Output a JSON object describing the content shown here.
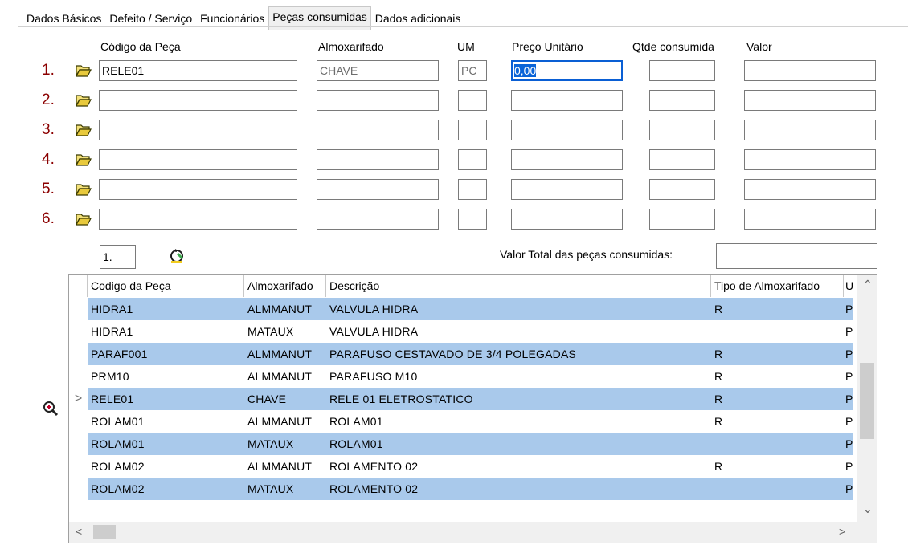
{
  "tabs": [
    {
      "label": "Dados Básicos"
    },
    {
      "label": "Defeito / Serviço"
    },
    {
      "label": "Funcionários"
    },
    {
      "label": "Peças consumidas"
    },
    {
      "label": "Dados adicionais"
    }
  ],
  "active_tab": "Peças consumidas",
  "columns": {
    "codigo": "Código da Peça",
    "almox": "Almoxarifado",
    "um": "UM",
    "preco": "Preço Unitário",
    "qtde": "Qtde consumida",
    "valor": "Valor"
  },
  "rows": [
    {
      "num": "1.",
      "codigo": "RELE01",
      "almox": "CHAVE",
      "um": "PC",
      "preco": "0,00",
      "qtde": "",
      "valor": ""
    },
    {
      "num": "2.",
      "codigo": "",
      "almox": "",
      "um": "",
      "preco": "",
      "qtde": "",
      "valor": ""
    },
    {
      "num": "3.",
      "codigo": "",
      "almox": "",
      "um": "",
      "preco": "",
      "qtde": "",
      "valor": ""
    },
    {
      "num": "4.",
      "codigo": "",
      "almox": "",
      "um": "",
      "preco": "",
      "qtde": "",
      "valor": ""
    },
    {
      "num": "5.",
      "codigo": "",
      "almox": "",
      "um": "",
      "preco": "",
      "qtde": "",
      "valor": ""
    },
    {
      "num": "6.",
      "codigo": "",
      "almox": "",
      "um": "",
      "preco": "",
      "qtde": "",
      "valor": ""
    }
  ],
  "page_field": "1.",
  "total_label": "Valor Total das peças consumidas:",
  "total_value": "",
  "grid": {
    "headers": [
      "Codigo da Peça",
      "Almoxarifado",
      "Descrição",
      "Tipo de Almoxarifado",
      "U"
    ],
    "rows": [
      {
        "codigo": "HIDRA1",
        "almox": "ALMMANUT",
        "descricao": "VALVULA HIDRA",
        "tipo": "R",
        "u": "P"
      },
      {
        "codigo": "HIDRA1",
        "almox": "MATAUX",
        "descricao": "VALVULA HIDRA",
        "tipo": "",
        "u": "P"
      },
      {
        "codigo": "PARAF001",
        "almox": "ALMMANUT",
        "descricao": "PARAFUSO CESTAVADO DE 3/4 POLEGADAS",
        "tipo": "R",
        "u": "P"
      },
      {
        "codigo": "PRM10",
        "almox": "ALMMANUT",
        "descricao": "PARAFUSO M10",
        "tipo": "R",
        "u": "P"
      },
      {
        "codigo": "RELE01",
        "almox": "CHAVE",
        "descricao": "RELE 01 ELETROSTATICO",
        "tipo": "R",
        "u": "P"
      },
      {
        "codigo": "ROLAM01",
        "almox": "ALMMANUT",
        "descricao": "ROLAM01",
        "tipo": "R",
        "u": "P"
      },
      {
        "codigo": "ROLAM01",
        "almox": "MATAUX",
        "descricao": "ROLAM01",
        "tipo": "",
        "u": "P"
      },
      {
        "codigo": "ROLAM02",
        "almox": "ALMMANUT",
        "descricao": "ROLAMENTO 02",
        "tipo": "R",
        "u": "P"
      },
      {
        "codigo": "ROLAM02",
        "almox": "MATAUX",
        "descricao": "ROLAMENTO 02",
        "tipo": "",
        "u": "P"
      }
    ],
    "current_row_indicator": ">"
  },
  "icons": {
    "folder": "folder-open-icon",
    "refresh": "refresh-icon",
    "zoom": "zoom-in-icon"
  },
  "colors": {
    "row_number": "#8b0000",
    "row_highlight": "#a9c9eb",
    "focus_border": "#0a5fd4"
  }
}
